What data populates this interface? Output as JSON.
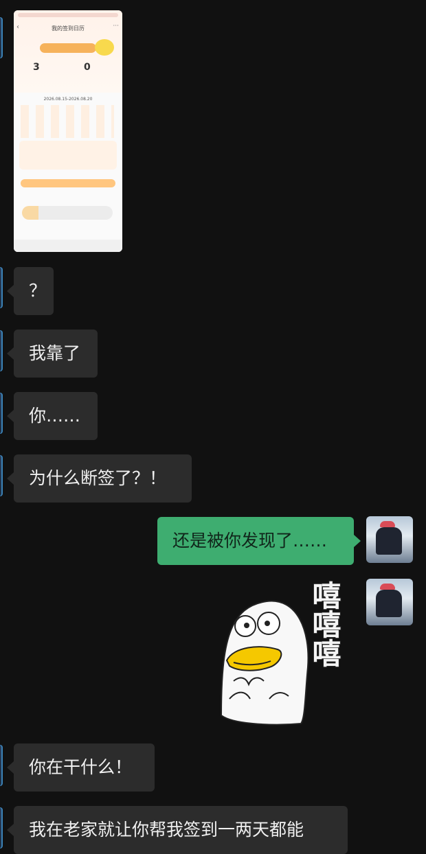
{
  "chat": {
    "messages": [
      {
        "id": "m1",
        "side": "left",
        "type": "image"
      },
      {
        "id": "m2",
        "side": "left",
        "type": "text",
        "text": "？"
      },
      {
        "id": "m3",
        "side": "left",
        "type": "text",
        "text": "我靠了"
      },
      {
        "id": "m4",
        "side": "left",
        "type": "text",
        "text": "你……"
      },
      {
        "id": "m5",
        "side": "left",
        "type": "text",
        "text": "为什么断签了？！"
      },
      {
        "id": "m6",
        "side": "right",
        "type": "text",
        "text": "还是被你发现了……"
      },
      {
        "id": "m7",
        "side": "right",
        "type": "sticker"
      },
      {
        "id": "m8",
        "side": "left",
        "type": "text",
        "text": "你在干什么！"
      },
      {
        "id": "m9",
        "side": "left",
        "type": "text",
        "text": "我在老家就让你帮我签到一两天都能"
      }
    ]
  },
  "image_message": {
    "app_title": "我的签到日历",
    "date_range": "2026.08.15-2026.08.20",
    "stats": {
      "left_value": "3",
      "right_value": "0"
    },
    "colors": {
      "accent": "#f6b25b",
      "button": "#ffc67f"
    }
  },
  "sticker": {
    "text": "嘻嘻嘻",
    "accent": "#f5c800"
  },
  "colors": {
    "background": "#111111",
    "left_bubble": "#2c2c2c",
    "right_bubble": "#3ead70"
  }
}
